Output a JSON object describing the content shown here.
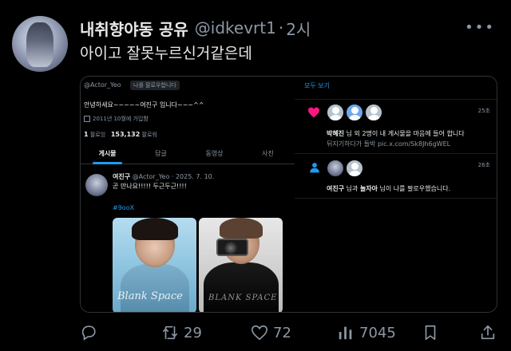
{
  "tweet": {
    "display_name": "내취향야동 공유",
    "handle": "@idkevrt1",
    "separator": "·",
    "time": "2시",
    "more_label": "•••",
    "text": "아이고 잘못누르신거같은데"
  },
  "embedded_profile": {
    "handle": "@Actor_Yeo",
    "follow_badge": "나를 팔로우합니다",
    "bio": "안녕하세요~~~~~여진구 입니다~~~^^",
    "joined": "2011년 10월에 가입함",
    "following_count": "1",
    "following_label": "팔로잉",
    "followers_count": "153,132",
    "followers_label": "팔로워",
    "tabs": [
      {
        "label": "게시물"
      },
      {
        "label": "답글"
      },
      {
        "label": "동영상"
      },
      {
        "label": "사진"
      }
    ]
  },
  "embedded_post": {
    "name": "여진구",
    "meta": "@Actor_Yeo · 2025. 7. 10.",
    "text": "곧 만나요!!!!! 두근두근!!!!",
    "hashtag": "#9ooX",
    "photo1_caption": "Blank Space",
    "photo2_caption": "BLANK SPACE"
  },
  "notifications": {
    "see_all": "모두 보기",
    "items": [
      {
        "date": "25초",
        "name": "박혜진",
        "text": " 님 외 2명이 내 게시물을 마음에 들어 합니다",
        "sub": "뒤지기하다가 들박 pic.x.com/Sk8Jh6gWEL"
      },
      {
        "date": "26초",
        "name": "여진구",
        "text": " 님과 ",
        "name2": "놀자아",
        "text2": " 님이 나를 팔로우했습니다."
      }
    ]
  },
  "actions": {
    "replies": "",
    "retweets": "29",
    "likes": "72",
    "views": "7045"
  },
  "colors": {
    "background": "#000000",
    "text": "#e7e9ea",
    "muted": "#8b98a5",
    "accent": "#1d9bf0",
    "heart": "#f91880"
  }
}
